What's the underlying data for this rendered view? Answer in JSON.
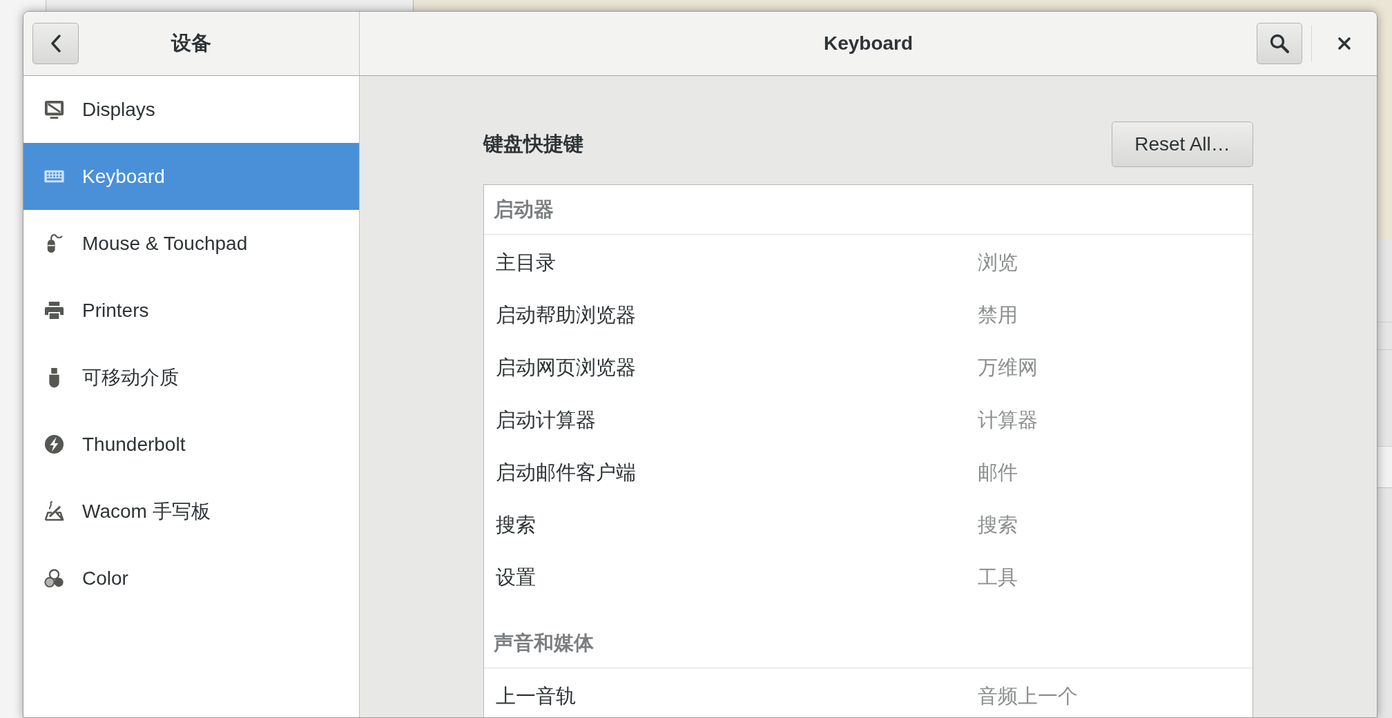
{
  "header": {
    "sidebar_title": "设备",
    "title": "Keyboard"
  },
  "sidebar": {
    "items": [
      {
        "label": "Displays",
        "selected": false
      },
      {
        "label": "Keyboard",
        "selected": true
      },
      {
        "label": "Mouse & Touchpad",
        "selected": false
      },
      {
        "label": "Printers",
        "selected": false
      },
      {
        "label": "可移动介质",
        "selected": false
      },
      {
        "label": "Thunderbolt",
        "selected": false
      },
      {
        "label": "Wacom 手写板",
        "selected": false
      },
      {
        "label": "Color",
        "selected": false
      }
    ]
  },
  "content": {
    "title": "键盘快捷键",
    "reset_button": "Reset All…",
    "sections": [
      {
        "title": "启动器",
        "shortcuts": [
          {
            "name": "主目录",
            "accelerator": "浏览"
          },
          {
            "name": "启动帮助浏览器",
            "accelerator": "禁用"
          },
          {
            "name": "启动网页浏览器",
            "accelerator": "万维网"
          },
          {
            "name": "启动计算器",
            "accelerator": "计算器"
          },
          {
            "name": "启动邮件客户端",
            "accelerator": "邮件"
          },
          {
            "name": "搜索",
            "accelerator": "搜索"
          },
          {
            "name": "设置",
            "accelerator": "工具"
          }
        ]
      },
      {
        "title": "声音和媒体",
        "shortcuts": [
          {
            "name": "上一音轨",
            "accelerator": "音频上一个"
          }
        ]
      }
    ]
  }
}
